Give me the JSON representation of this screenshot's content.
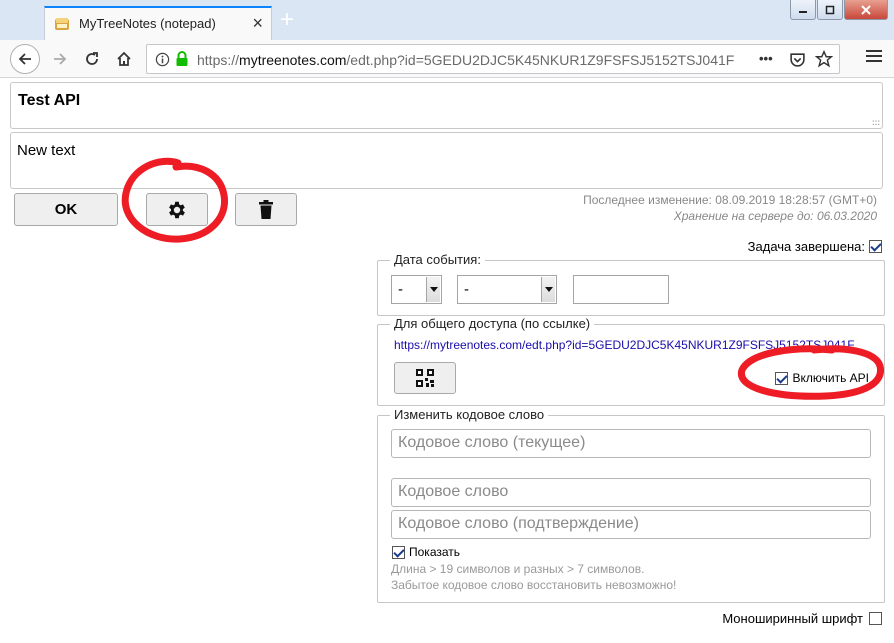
{
  "browser": {
    "tab_title": "MyTreeNotes (notepad)",
    "tab_close": "×",
    "new_tab": "+",
    "url_prefix": "https://",
    "url_host": "mytreenotes.com",
    "url_path": "/edt.php?id=5GEDU2DJC5K45NKUR1Z9FSFSJ5152TSJ041F",
    "page_actions": "•••",
    "window_controls": [
      "minimize",
      "maximize",
      "close"
    ],
    "accent": "#0a84ff"
  },
  "note": {
    "title": "Test API",
    "text": "New text",
    "grip": ":::"
  },
  "toolbar": {
    "ok_label": "OK",
    "settings_icon": "gear-icon",
    "delete_icon": "trash-icon"
  },
  "meta": {
    "last_modified": "Последнее изменение: 08.09.2019 18:28:57 (GMT+0)",
    "storage_until": "Хранение на сервере до: 06.03.2020"
  },
  "task": {
    "label": "Задача завершена:",
    "checked": true
  },
  "event_date": {
    "legend": "Дата события:",
    "day_value": "-",
    "month_value": "-",
    "time_value": ""
  },
  "sharing": {
    "legend": "Для общего доступа (по ссылке)",
    "link": "https://mytreenotes.com/edt.php?id=5GEDU2DJC5K45NKUR1Z9FSFSJ5152TSJ041F",
    "qr_icon": "qr-code-icon",
    "api_label": "Включить API",
    "api_checked": true
  },
  "password": {
    "legend": "Изменить кодовое слово",
    "current_placeholder": "Кодовое слово (текущее)",
    "new_placeholder": "Кодовое слово",
    "confirm_placeholder": "Кодовое слово (подтверждение)",
    "show_label": "Показать",
    "show_checked": true,
    "hint_length": "Длина > 19 символов и разных > 7 символов.",
    "hint_recovery": "Забытое кодовое слово восстановить невозможно!"
  },
  "mono_font": {
    "label": "Моноширинный шрифт",
    "checked": false
  },
  "colors": {
    "annotation_red": "#ee1c25",
    "link_blue": "#1a0dab",
    "lock_green": "#12bc00"
  }
}
